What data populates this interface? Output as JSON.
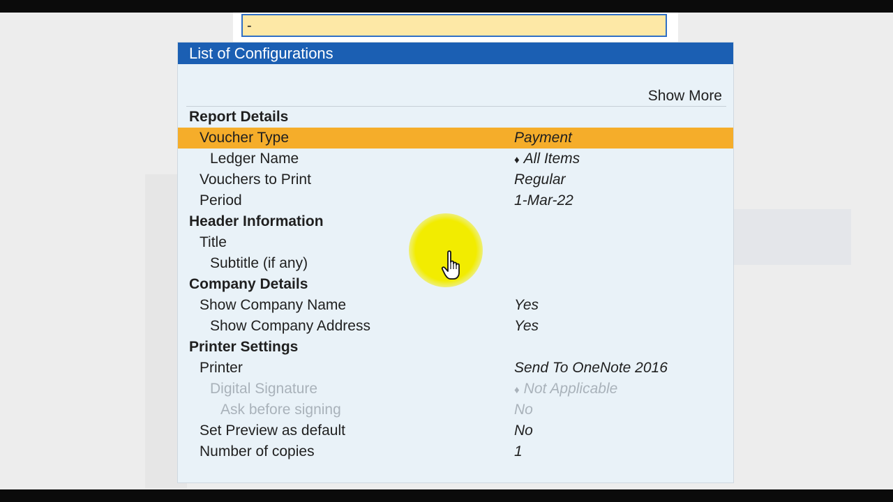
{
  "input": {
    "value": "-"
  },
  "dialog": {
    "title": "List of Configurations",
    "show_more": "Show More",
    "rows": [
      {
        "label": "Report Details",
        "value": "",
        "level": 0,
        "section": true
      },
      {
        "label": "Voucher Type",
        "value": "Payment",
        "level": 1,
        "selected": true
      },
      {
        "label": "Ledger Name",
        "value": "All Items",
        "level": 2,
        "marker": "♦"
      },
      {
        "label": "Vouchers to Print",
        "value": "Regular",
        "level": 1
      },
      {
        "label": "Period",
        "value": "1-Mar-22",
        "level": 1
      },
      {
        "label": "Header Information",
        "value": "",
        "level": 0,
        "section": true
      },
      {
        "label": "Title",
        "value": "",
        "level": 1
      },
      {
        "label": "Subtitle (if any)",
        "value": "",
        "level": 2
      },
      {
        "label": "Company Details",
        "value": "",
        "level": 0,
        "section": true
      },
      {
        "label": "Show Company Name",
        "value": "Yes",
        "level": 1
      },
      {
        "label": "Show Company Address",
        "value": "Yes",
        "level": 2
      },
      {
        "label": "Printer Settings",
        "value": "",
        "level": 0,
        "section": true
      },
      {
        "label": "Printer",
        "value": "Send To OneNote 2016",
        "level": 1
      },
      {
        "label": "Digital Signature",
        "value": "Not Applicable",
        "level": 2,
        "marker": "♦",
        "disabled": true
      },
      {
        "label": "Ask before signing",
        "value": "No",
        "level": 3,
        "disabled": true
      },
      {
        "label": "Set Preview as default",
        "value": "No",
        "level": 1
      },
      {
        "label": "Number of copies",
        "value": "1",
        "level": 1
      }
    ]
  },
  "colors": {
    "title_bar": "#1b5fb3",
    "selection": "#f5ad2a",
    "dialog_bg": "#e9f2f8",
    "input_bg": "#fde8a6",
    "cursor_highlight": "#f2ec00"
  },
  "icons": {
    "pointer": "hand-pointer-icon"
  }
}
